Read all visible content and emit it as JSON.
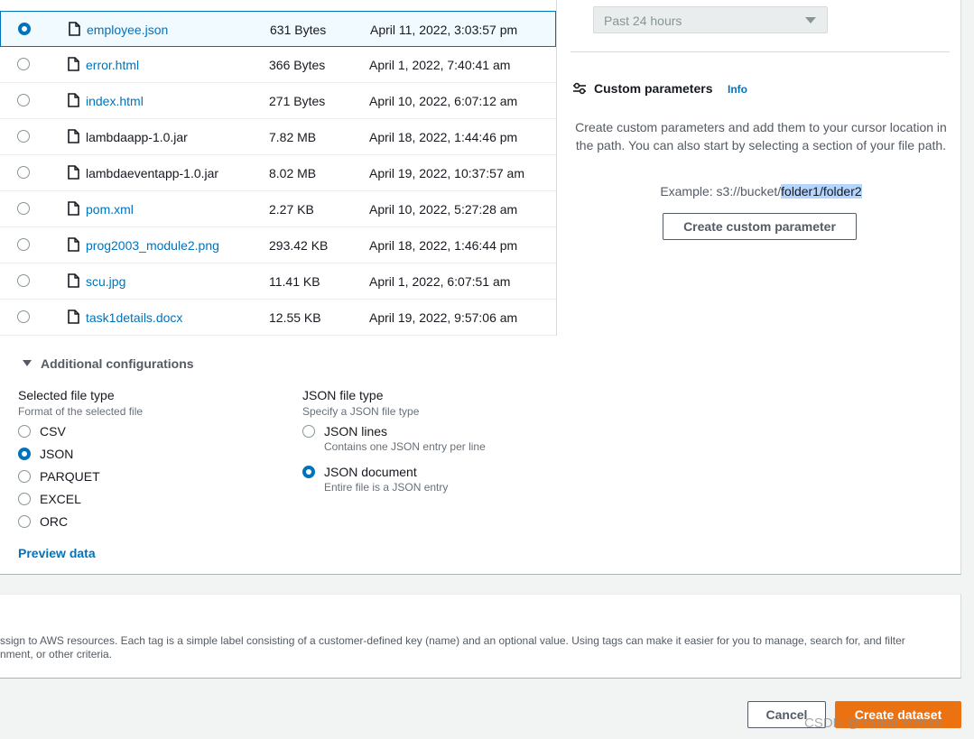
{
  "files": [
    {
      "name": "employee.json",
      "size": "631 Bytes",
      "modified": "April 11, 2022, 3:03:57 pm",
      "is_link": true,
      "selected": true
    },
    {
      "name": "error.html",
      "size": "366 Bytes",
      "modified": "April 1, 2022, 7:40:41 am",
      "is_link": true,
      "selected": false
    },
    {
      "name": "index.html",
      "size": "271 Bytes",
      "modified": "April 10, 2022, 6:07:12 am",
      "is_link": true,
      "selected": false
    },
    {
      "name": "lambdaapp-1.0.jar",
      "size": "7.82 MB",
      "modified": "April 18, 2022, 1:44:46 pm",
      "is_link": false,
      "selected": false
    },
    {
      "name": "lambdaeventapp-1.0.jar",
      "size": "8.02 MB",
      "modified": "April 19, 2022, 10:37:57 am",
      "is_link": false,
      "selected": false
    },
    {
      "name": "pom.xml",
      "size": "2.27 KB",
      "modified": "April 10, 2022, 5:27:28 am",
      "is_link": true,
      "selected": false
    },
    {
      "name": "prog2003_module2.png",
      "size": "293.42 KB",
      "modified": "April 18, 2022, 1:46:44 pm",
      "is_link": true,
      "selected": false
    },
    {
      "name": "scu.jpg",
      "size": "11.41 KB",
      "modified": "April 1, 2022, 6:07:51 am",
      "is_link": true,
      "selected": false
    },
    {
      "name": "task1details.docx",
      "size": "12.55 KB",
      "modified": "April 19, 2022, 9:57:06 am",
      "is_link": true,
      "selected": false
    }
  ],
  "time_filter": {
    "value": "Past 24 hours"
  },
  "custom_parameters": {
    "title": "Custom parameters",
    "info": "Info",
    "description": "Create custom parameters and add them to your cursor location in the path. You can also start by selecting a section of your file path.",
    "example_prefix": "Example: s3://bucket/",
    "example_highlight": "folder1/folder2",
    "button": "Create custom parameter"
  },
  "additional_config": {
    "title": "Additional configurations",
    "file_type": {
      "label": "Selected file type",
      "description": "Format of the selected file",
      "options": [
        "CSV",
        "JSON",
        "PARQUET",
        "EXCEL",
        "ORC"
      ],
      "selected": "JSON"
    },
    "json_type": {
      "label": "JSON file type",
      "description": "Specify a JSON file type",
      "options": [
        {
          "label": "JSON lines",
          "sub": "Contains one JSON entry per line"
        },
        {
          "label": "JSON document",
          "sub": "Entire file is a JSON entry"
        }
      ],
      "selected": "JSON document"
    },
    "preview": "Preview data"
  },
  "tags": {
    "line1": "ssign to AWS resources. Each tag is a simple label consisting of a customer-defined key (name) and an optional value. Using tags can make it easier for you to manage, search for, and filter",
    "line2": "nment, or other criteria."
  },
  "footer": {
    "cancel": "Cancel",
    "create": "Create dataset"
  },
  "watermark": "CSDN @Yamai Yuzuru",
  "colors": {
    "accent": "#0073bb",
    "primary_button": "#ec7211"
  }
}
